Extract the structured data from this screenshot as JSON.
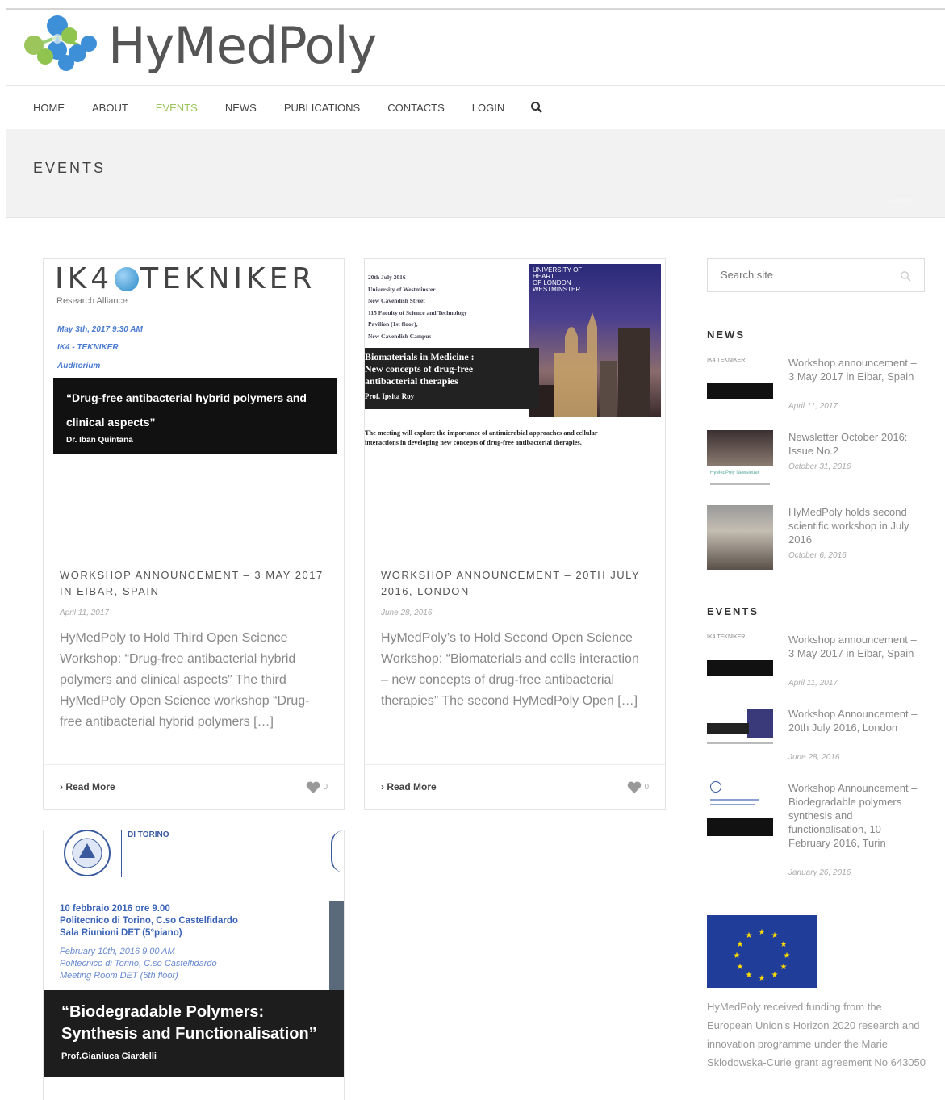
{
  "site": {
    "logo_text": "HyMedPoly",
    "nav": [
      "HOME",
      "ABOUT",
      "EVENTS",
      "NEWS",
      "PUBLICATIONS",
      "CONTACTS",
      "LOGIN"
    ],
    "active_nav": "EVENTS",
    "accent_color": "#9cc55b"
  },
  "page": {
    "title": "EVENTS",
    "breadcrumb": "events"
  },
  "cards": [
    {
      "image": {
        "logo": "IK4",
        "logo_suffix": "TEKNIKER",
        "logo_sub": "Research Alliance",
        "lines": [
          "May 3th, 2017 9:30 AM",
          "IK4 - TEKNIKER",
          "Auditorium"
        ],
        "box_title": "“Drug-free antibacterial hybrid polymers and clinical aspects”",
        "box_author": "Dr. Iban Quintana"
      },
      "title": "Workshop announcement – 3 May 2017 in Eibar, Spain",
      "date": "April 11, 2017",
      "excerpt": " HyMedPoly  to Hold Third Open Science Workshop: “Drug-free antibacterial hybrid polymers and clinical aspects” The third HyMedPoly Open Science workshop “Drug-free antibacterial hybrid polymers […]",
      "read_more": "Read More",
      "likes": "0"
    },
    {
      "image": {
        "info_lines": [
          "20th July 2016",
          "University of Westminster",
          "New Cavendish Street",
          "115 Faculty of Science and Technology",
          "Pavilion (1st floor),",
          "New Cavendish Campus"
        ],
        "uni_lines": [
          "UNIVERSITY OF",
          "HEART",
          "OF LONDON",
          "WESTMINSTER"
        ],
        "box_lines": [
          "Biomaterials in Medicine :",
          "New concepts of drug-free",
          "antibacterial therapies"
        ],
        "box_author": "Prof. Ipsita Roy",
        "caption_lines": [
          "The meeting will explore the importance of antimicrobial approaches and cellular",
          "interactions in developing new concepts of drug-free antibacterial therapies."
        ]
      },
      "title": "Workshop announcement – 20th July 2016, London",
      "date": "June 28, 2016",
      "excerpt": " HyMedPoly’s to Hold Second Open Science Workshop: “Biomaterials and cells interaction – new concepts of drug-free antibacterial therapies” The second HyMedPoly Open […]",
      "read_more": "Read More",
      "likes": "0"
    },
    {
      "image": {
        "header": "DI TORINO",
        "it_lines": [
          "10 febbraio 2016 ore 9.00",
          "Politecnico di Torino, C.so Castelfidardo",
          "Sala Riunioni DET (5°piano)"
        ],
        "en_lines": [
          "February 10th, 2016 9.00 AM",
          "Politecnico di Torino, C.so Castelfidardo",
          "Meeting Room DET (5th floor)"
        ],
        "box_lines": [
          "“Biodegradable Polymers:",
          "Synthesis and Functionalisation”"
        ],
        "box_author": "Prof.Gianluca Ciardelli"
      }
    }
  ],
  "sidebar": {
    "search_placeholder": "Search site",
    "news_heading": "NEWS",
    "news": [
      {
        "title": "Workshop announcement – 3 May 2017 in Eibar, Spain",
        "date": "April 11, 2017"
      },
      {
        "title": "Newsletter October 2016: Issue No.2",
        "date": "October 31, 2016"
      },
      {
        "title": "HyMedPoly holds second scientific workshop in July 2016",
        "date": "October 6, 2016"
      }
    ],
    "events_heading": "EVENTS",
    "events": [
      {
        "title": "Workshop announcement – 3 May 2017 in Eibar, Spain",
        "date": "April 11, 2017"
      },
      {
        "title": "Workshop Announcement – 20th July 2016, London",
        "date": "June 28, 2016"
      },
      {
        "title": "Workshop Announcement – Biodegradable polymers synthesis and functionalisation, 10 February 2016, Turin",
        "date": "January 26, 2016"
      }
    ],
    "funding_text": "HyMedPoly received funding from the European Union’s Horizon 2020 research and innovation programme under the Marie Sklodowska-Curie grant agreement No 643050"
  }
}
